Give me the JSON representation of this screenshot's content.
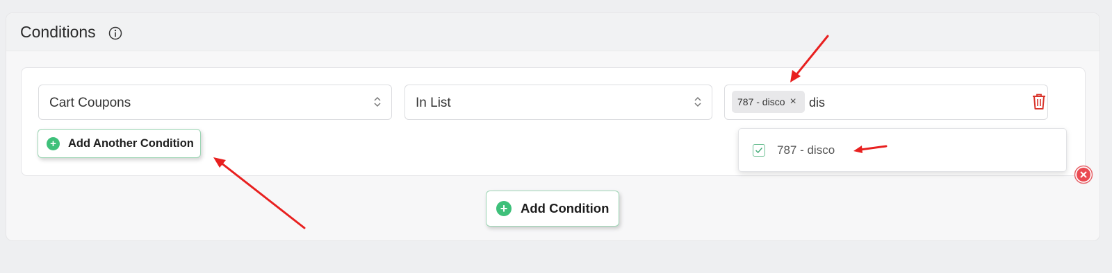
{
  "panel": {
    "title": "Conditions",
    "info_icon": "info-circle-icon"
  },
  "condition_row": {
    "field_select": {
      "value": "Cart Coupons"
    },
    "operator_select": {
      "value": "In List"
    },
    "values_select": {
      "chips": [
        {
          "label": "787 - disco"
        }
      ],
      "search_text": "dis"
    }
  },
  "buttons": {
    "add_another_label": "Add Another Condition",
    "add_condition_label": "Add Condition"
  },
  "dropdown": {
    "options": [
      {
        "label": "787 - disco",
        "checked": true
      }
    ]
  },
  "colors": {
    "accent_green": "#3ec07a",
    "delete_red": "#d9342b",
    "annotation_red": "#e8201f"
  }
}
